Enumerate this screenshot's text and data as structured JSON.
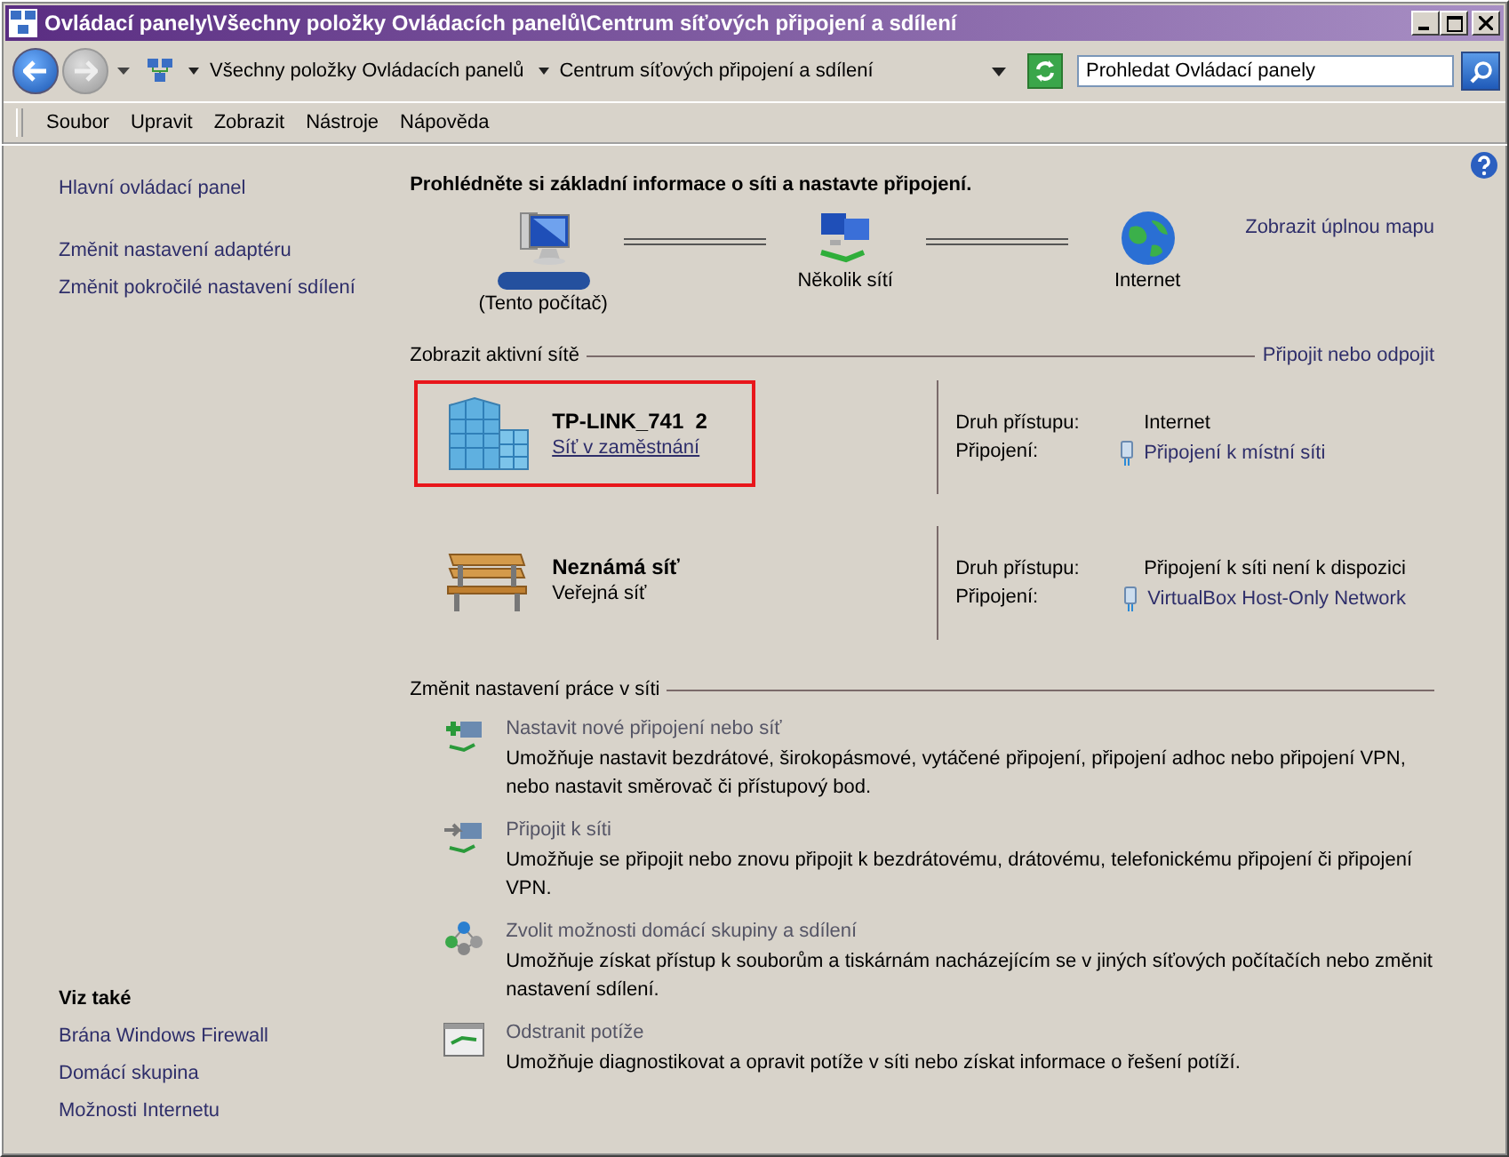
{
  "window": {
    "title": "Ovládací panely\\Všechny položky Ovládacích panelů\\Centrum síťových připojení a sdílení"
  },
  "address": {
    "breadcrumbs": [
      "Všechny položky Ovládacích panelů",
      "Centrum síťových připojení a sdílení"
    ],
    "search_placeholder": "Prohledat Ovládací panely"
  },
  "menu": [
    "Soubor",
    "Upravit",
    "Zobrazit",
    "Nástroje",
    "Nápověda"
  ],
  "sidebar": {
    "links": [
      "Hlavní ovládací panel",
      "Změnit nastavení adaptéru",
      "Změnit pokročilé nastavení sdílení"
    ],
    "see_also_title": "Viz také",
    "see_also": [
      "Brána Windows Firewall",
      "Domácí skupina",
      "Možnosti Internetu"
    ]
  },
  "heading": "Prohlédněte si základní informace o síti a nastavte připojení.",
  "map": {
    "nodes": [
      {
        "kind": "computer",
        "label": "(Tento počítač)",
        "redacted": true
      },
      {
        "kind": "multi",
        "label": "Několik sítí",
        "redacted": false
      },
      {
        "kind": "internet",
        "label": "Internet",
        "redacted": false
      }
    ],
    "full_map_link": "Zobrazit úplnou mapu"
  },
  "active": {
    "title": "Zobrazit aktivní sítě",
    "link": "Připojit nebo odpojit",
    "networks": [
      {
        "kind": "work",
        "name": "TP-LINK_741  2",
        "type": "Síť v zaměstnání",
        "type_is_link": true,
        "highlighted": true,
        "access_label": "Druh přístupu:",
        "access_value": "Internet",
        "connection_label": "Připojení:",
        "connection_value": "Připojení k místní síti"
      },
      {
        "kind": "public",
        "name": "Neznámá síť",
        "type": "Veřejná síť",
        "type_is_link": false,
        "highlighted": false,
        "access_label": "Druh přístupu:",
        "access_value": "Připojení k síti není k dispozici",
        "connection_label": "Připojení:",
        "connection_value": "VirtualBox Host-Only Network"
      }
    ]
  },
  "tasks": {
    "title": "Změnit nastavení práce v síti",
    "items": [
      {
        "kind": "new",
        "title": "Nastavit nové připojení nebo síť",
        "description": "Umožňuje nastavit bezdrátové, širokopásmové, vytáčené připojení, připojení adhoc nebo připojení VPN, nebo nastavit směrovač či přístupový bod."
      },
      {
        "kind": "connect",
        "title": "Připojit k síti",
        "description": "Umožňuje se připojit nebo znovu připojit k bezdrátovému, drátovému, telefonickému připojení či připojení VPN."
      },
      {
        "kind": "homegroup",
        "title": "Zvolit možnosti domácí skupiny a sdílení",
        "description": "Umožňuje získat přístup k souborům a tiskárnám nacházejícím se v jiných síťových počítačích nebo změnit nastavení sdílení."
      },
      {
        "kind": "troubleshoot",
        "title": "Odstranit potíže",
        "description": "Umožňuje diagnostikovat a opravit potíže v síti nebo získat informace o řešení potíží."
      }
    ]
  }
}
